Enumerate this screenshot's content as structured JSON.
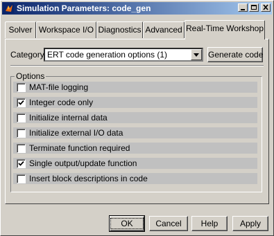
{
  "window": {
    "title": "Simulation Parameters: code_gen"
  },
  "tabs": [
    {
      "label": "Solver",
      "active": false
    },
    {
      "label": "Workspace I/O",
      "active": false
    },
    {
      "label": "Diagnostics",
      "active": false
    },
    {
      "label": "Advanced",
      "active": false
    },
    {
      "label": "Real-Time Workshop",
      "active": true
    }
  ],
  "category": {
    "label": "Category:",
    "value": "ERT code generation options (1)",
    "generate_button": "Generate code"
  },
  "options": {
    "title": "Options",
    "items": [
      {
        "label": "MAT-file logging",
        "checked": false
      },
      {
        "label": "Integer code only",
        "checked": true
      },
      {
        "label": "Initialize internal data",
        "checked": false
      },
      {
        "label": "Initialize external I/O data",
        "checked": false
      },
      {
        "label": "Terminate function required",
        "checked": false
      },
      {
        "label": "Single output/update function",
        "checked": true
      },
      {
        "label": "Insert block descriptions in code",
        "checked": false
      }
    ]
  },
  "buttons": {
    "ok": "OK",
    "cancel": "Cancel",
    "help": "Help",
    "apply": "Apply"
  }
}
